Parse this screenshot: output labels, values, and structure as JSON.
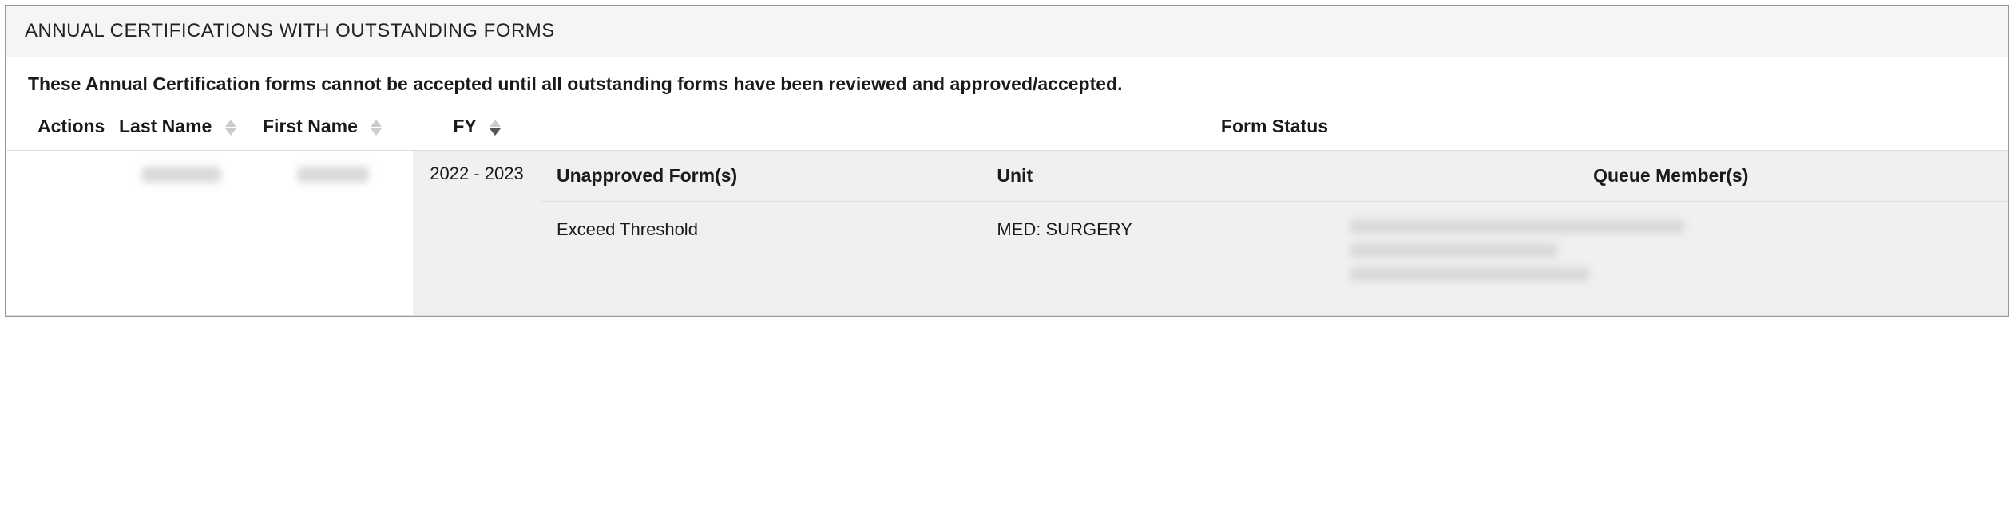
{
  "panel": {
    "title": "ANNUAL CERTIFICATIONS WITH OUTSTANDING FORMS",
    "notice": "These Annual Certification forms cannot be accepted until all outstanding forms have been reviewed and approved/accepted."
  },
  "columns": {
    "actions": "Actions",
    "last_name": "Last Name",
    "first_name": "First Name",
    "fy": "FY",
    "form_status": "Form Status"
  },
  "inner_columns": {
    "unapproved": "Unapproved Form(s)",
    "unit": "Unit",
    "queue": "Queue Member(s)"
  },
  "rows": [
    {
      "actions": "",
      "last_name": "[redacted]",
      "first_name": "[redacted]",
      "fy": "2022 - 2023",
      "forms": [
        {
          "unapproved": "Exceed Threshold",
          "unit": "MED: SURGERY",
          "queue_members": "[redacted]"
        }
      ]
    }
  ]
}
